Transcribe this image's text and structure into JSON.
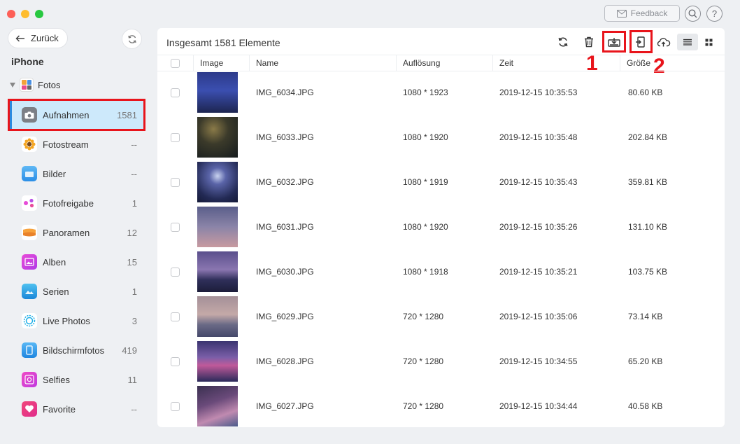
{
  "colors": {
    "accent": "#2a8be0",
    "highlight_red": "#e8141b",
    "active_bg": "#cde9fb"
  },
  "titlebar": {
    "feedback_label": "Feedback",
    "search_icon": "search-icon",
    "help_label": "?"
  },
  "sidebar": {
    "back_label": "Zurück",
    "device_name": "iPhone",
    "group_label": "Fotos",
    "items": [
      {
        "label": "Aufnahmen",
        "count": "1581",
        "icon": "camera-icon",
        "active": true
      },
      {
        "label": "Fotostream",
        "count": "--",
        "icon": "sunflower-icon"
      },
      {
        "label": "Bilder",
        "count": "--",
        "icon": "folder-icon"
      },
      {
        "label": "Fotofreigabe",
        "count": "1",
        "icon": "share-icon"
      },
      {
        "label": "Panoramen",
        "count": "12",
        "icon": "panorama-icon"
      },
      {
        "label": "Alben",
        "count": "15",
        "icon": "album-icon"
      },
      {
        "label": "Serien",
        "count": "1",
        "icon": "burst-icon"
      },
      {
        "label": "Live Photos",
        "count": "3",
        "icon": "live-photo-icon"
      },
      {
        "label": "Bildschirmfotos",
        "count": "419",
        "icon": "screenshot-icon"
      },
      {
        "label": "Selfies",
        "count": "11",
        "icon": "selfie-icon"
      },
      {
        "label": "Favorite",
        "count": "--",
        "icon": "heart-icon"
      }
    ]
  },
  "main": {
    "title": "Insgesamt 1581 Elemente",
    "callout_1": "1",
    "callout_2": "2",
    "columns": {
      "image": "Image",
      "name": "Name",
      "resolution": "Auflösung",
      "time": "Zeit",
      "size": "Größe"
    },
    "rows": [
      {
        "name": "IMG_6034.JPG",
        "resolution": "1080 * 1923",
        "time": "2019-12-15 10:35:53",
        "size": "80.60 KB"
      },
      {
        "name": "IMG_6033.JPG",
        "resolution": "1080 * 1920",
        "time": "2019-12-15 10:35:48",
        "size": "202.84 KB"
      },
      {
        "name": "IMG_6032.JPG",
        "resolution": "1080 * 1919",
        "time": "2019-12-15 10:35:43",
        "size": "359.81 KB"
      },
      {
        "name": "IMG_6031.JPG",
        "resolution": "1080 * 1920",
        "time": "2019-12-15 10:35:26",
        "size": "131.10 KB"
      },
      {
        "name": "IMG_6030.JPG",
        "resolution": "1080 * 1918",
        "time": "2019-12-15 10:35:21",
        "size": "103.75 KB"
      },
      {
        "name": "IMG_6029.JPG",
        "resolution": "720 * 1280",
        "time": "2019-12-15 10:35:06",
        "size": "73.14 KB"
      },
      {
        "name": "IMG_6028.JPG",
        "resolution": "720 * 1280",
        "time": "2019-12-15 10:34:55",
        "size": "65.20 KB"
      },
      {
        "name": "IMG_6027.JPG",
        "resolution": "720 * 1280",
        "time": "2019-12-15 10:34:44",
        "size": "40.58 KB"
      }
    ]
  }
}
